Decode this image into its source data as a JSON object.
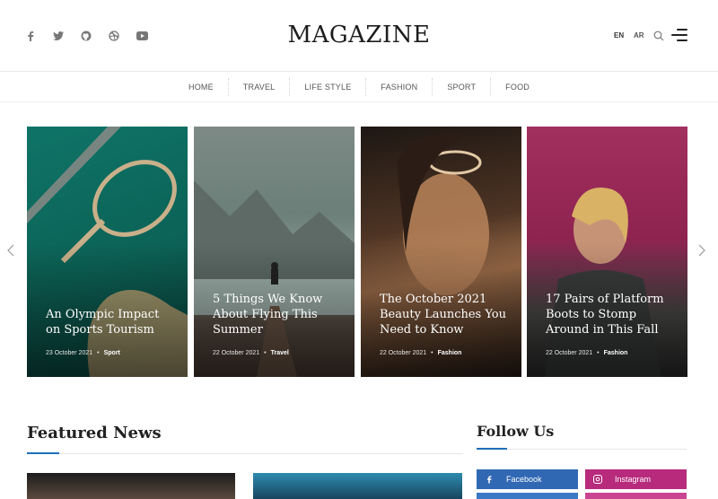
{
  "header": {
    "logo": "MAGAZINE",
    "social_icons": [
      "facebook-icon",
      "twitter-icon",
      "github-icon",
      "dribbble-icon",
      "youtube-icon"
    ],
    "lang_en": "EN",
    "lang_ar": "AR"
  },
  "nav": {
    "items": [
      "HOME",
      "TRAVEL",
      "LIFE STYLE",
      "FASHION",
      "SPORT",
      "FOOD"
    ]
  },
  "slider": {
    "cards": [
      {
        "title": "An Olympic Impact on Sports Tourism",
        "date": "23 October 2021",
        "category": "Sport"
      },
      {
        "title": "5 Things We Know About Flying This Summer",
        "date": "22 October 2021",
        "category": "Travel"
      },
      {
        "title": "The October 2021 Beauty Launches You Need to Know",
        "date": "22 October 2021",
        "category": "Fashion"
      },
      {
        "title": "17 Pairs of Platform Boots to Stomp Around in This Fall",
        "date": "22 October 2021",
        "category": "Fashion"
      }
    ]
  },
  "featured": {
    "title": "Featured News"
  },
  "follow": {
    "title": "Follow Us",
    "facebook_label": "Facebook",
    "instagram_label": "Instagram"
  },
  "colors": {
    "accent": "#1e6fb8",
    "facebook": "#3168b4",
    "instagram": "#b72a7c"
  }
}
